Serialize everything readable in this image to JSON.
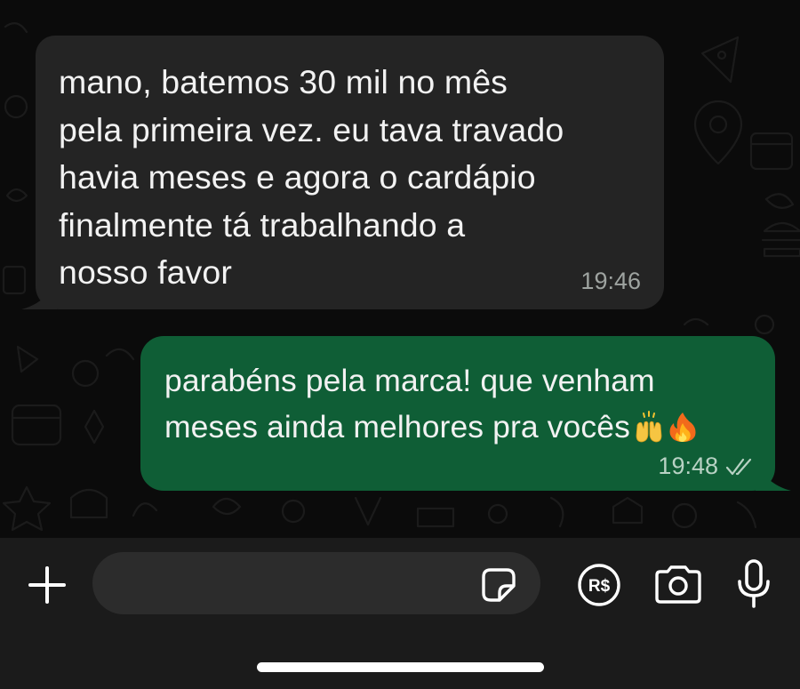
{
  "conversation": {
    "messages": [
      {
        "direction": "incoming",
        "text": "mano, batemos 30 mil no mês\npela primeira vez. eu tava travado\nhavia meses e agora o cardápio\nfinalmente tá trabalhando a\nnosso favor",
        "time": "19:46"
      },
      {
        "direction": "outgoing",
        "text": "parabéns pela marca! que venham\nmeses ainda melhores pra vocês",
        "emojis": [
          "raising-hands",
          "fire"
        ],
        "time": "19:48",
        "status": "read",
        "status_icon": "double-check-icon"
      }
    ]
  },
  "composer": {
    "placeholder": "",
    "value": "",
    "icons": [
      "plus-icon",
      "sticker-icon",
      "brl-payment-icon",
      "camera-icon",
      "microphone-icon"
    ],
    "pay_label": "R$"
  },
  "colors": {
    "background": "#0b0b0b",
    "incoming_bubble": "#242424",
    "outgoing_bubble": "#0f5e36",
    "composer_bar": "#1b1b1b",
    "composer_field": "#2c2c2c"
  }
}
